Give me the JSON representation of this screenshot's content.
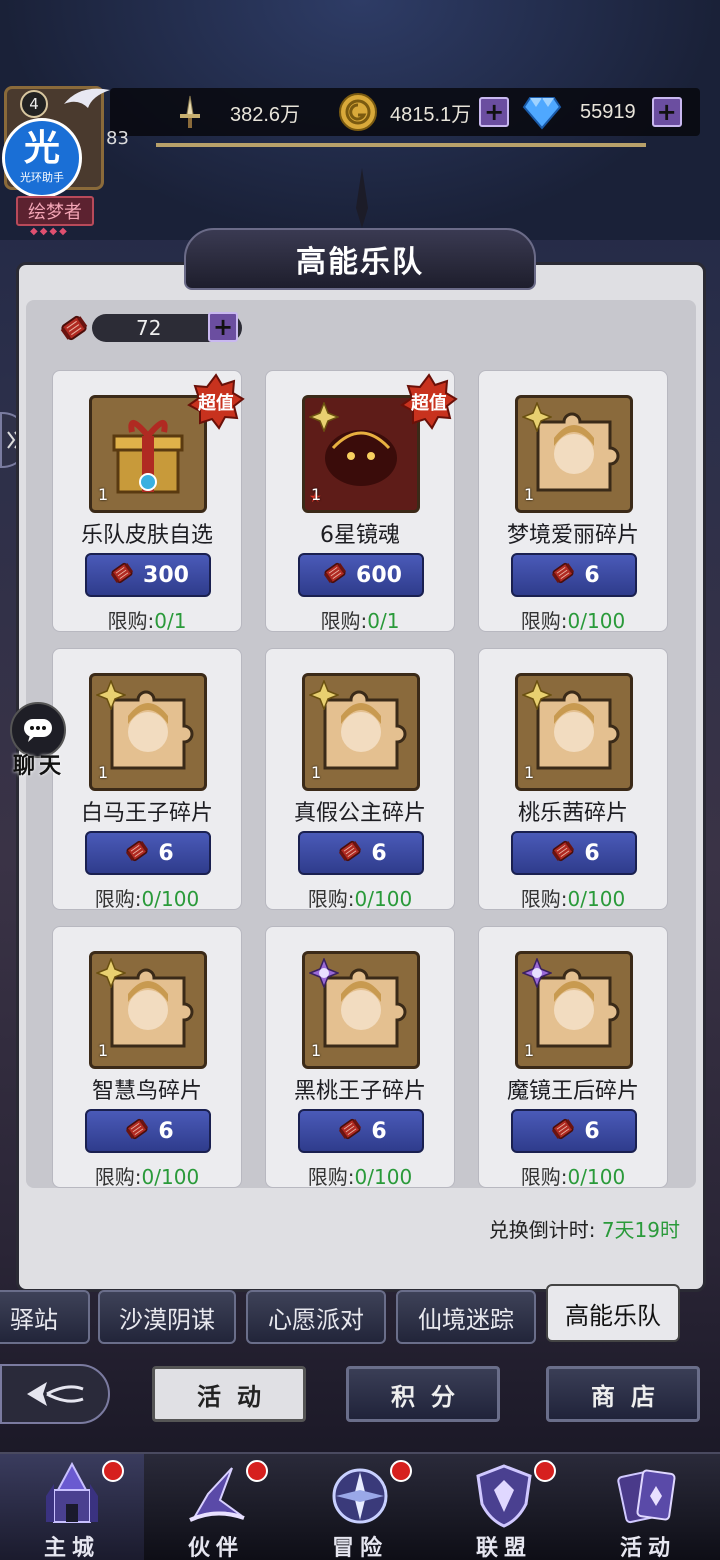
{
  "player": {
    "level": "4",
    "sub_level": "83",
    "avatar_char": "光",
    "avatar_sub": "光环助手",
    "title": "绘梦者"
  },
  "resources": {
    "power": "382.6万",
    "gold": "4815.1万",
    "diamond": "55919"
  },
  "panel": {
    "title": "高能乐队",
    "ticket_count": "72",
    "countdown_label": "兑换倒计时:",
    "countdown_value": "7天19时"
  },
  "items": [
    {
      "name": "乐队皮肤自选",
      "qty": "1",
      "price": "300",
      "limit_label": "限购:",
      "limit": "0/1",
      "badge": "超值"
    },
    {
      "name": "6星镜魂",
      "qty": "1",
      "price": "600",
      "limit_label": "限购:",
      "limit": "0/1",
      "badge": "超值"
    },
    {
      "name": "梦境爱丽碎片",
      "qty": "1",
      "price": "6",
      "limit_label": "限购:",
      "limit": "0/100"
    },
    {
      "name": "白马王子碎片",
      "qty": "1",
      "price": "6",
      "limit_label": "限购:",
      "limit": "0/100"
    },
    {
      "name": "真假公主碎片",
      "qty": "1",
      "price": "6",
      "limit_label": "限购:",
      "limit": "0/100"
    },
    {
      "name": "桃乐茜碎片",
      "qty": "1",
      "price": "6",
      "limit_label": "限购:",
      "limit": "0/100"
    },
    {
      "name": "智慧鸟碎片",
      "qty": "1",
      "price": "6",
      "limit_label": "限购:",
      "limit": "0/100"
    },
    {
      "name": "黑桃王子碎片",
      "qty": "1",
      "price": "6",
      "limit_label": "限购:",
      "limit": "0/100"
    },
    {
      "name": "魔镜王后碎片",
      "qty": "1",
      "price": "6",
      "limit_label": "限购:",
      "limit": "0/100"
    }
  ],
  "tabs": [
    "驿站",
    "沙漠阴谋",
    "心愿派对",
    "仙境迷踪",
    "高能乐队"
  ],
  "actions": {
    "activity": "活动",
    "points": "积分",
    "shop": "商店"
  },
  "chat_label": "聊天",
  "nav": [
    "主城",
    "伙伴",
    "冒险",
    "联盟",
    "活动"
  ]
}
